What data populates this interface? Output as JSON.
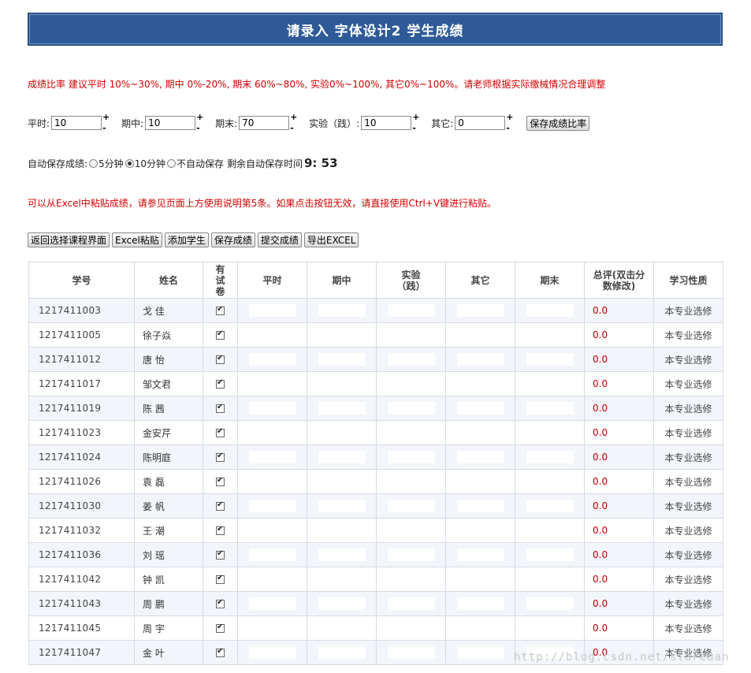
{
  "header": {
    "title": "请录入 字体设计2 学生成绩"
  },
  "notes": {
    "ratio_hint": "成绩比率 建议平时 10%~30%, 期中 0%-20%, 期末 60%~80%, 实验0%~100%, 其它0%~100%。请老师根据实际缴械情况合理调整",
    "excel_hint": "可以从Excel中粘贴成绩，请参见页面上方使用说明第5条。如果点击按钮无效，请直接使用Ctrl+V键进行粘贴。"
  },
  "ratios": [
    {
      "label": "平时:",
      "value": "10"
    },
    {
      "label": "期中:",
      "value": "10"
    },
    {
      "label": "期末:",
      "value": "70"
    },
    {
      "label": "实验（践）:",
      "value": "10"
    },
    {
      "label": "其它:",
      "value": "0"
    }
  ],
  "stepper": {
    "plus": "+",
    "minus": "-"
  },
  "save_ratio_label": "保存成绩比率",
  "autosave": {
    "label": "自动保存成绩:",
    "options": [
      "5分钟",
      "10分钟",
      "不自动保存"
    ],
    "selected_index": 1,
    "remaining_label": "剩余自动保存时间",
    "timer": "9: 53"
  },
  "toolbar": {
    "back": "返回选择课程界面",
    "paste": "Excel粘贴",
    "add": "添加学生",
    "save": "保存成绩",
    "submit": "提交成绩",
    "export": "导出EXCEL"
  },
  "table": {
    "headers": [
      "学号",
      "姓名",
      "有试卷",
      "平时",
      "期中",
      "实验（践）",
      "其它",
      "期末",
      "总评(双击分数修改)",
      "学习性质"
    ],
    "rows": [
      {
        "id": "1217411003",
        "name": "戈 佳",
        "total": "0.0",
        "nature": "本专业选修"
      },
      {
        "id": "1217411005",
        "name": "徐子焱",
        "total": "0.0",
        "nature": "本专业选修"
      },
      {
        "id": "1217411012",
        "name": "唐 怡",
        "total": "0.0",
        "nature": "本专业选修"
      },
      {
        "id": "1217411017",
        "name": "邹文君",
        "total": "0.0",
        "nature": "本专业选修"
      },
      {
        "id": "1217411019",
        "name": "陈 茜",
        "total": "0.0",
        "nature": "本专业选修"
      },
      {
        "id": "1217411023",
        "name": "金安芹",
        "total": "0.0",
        "nature": "本专业选修"
      },
      {
        "id": "1217411024",
        "name": "陈明庭",
        "total": "0.0",
        "nature": "本专业选修"
      },
      {
        "id": "1217411026",
        "name": "袁 磊",
        "total": "0.0",
        "nature": "本专业选修"
      },
      {
        "id": "1217411030",
        "name": "姜 帆",
        "total": "0.0",
        "nature": "本专业选修"
      },
      {
        "id": "1217411032",
        "name": "王 潮",
        "total": "0.0",
        "nature": "本专业选修"
      },
      {
        "id": "1217411036",
        "name": "刘 瑶",
        "total": "0.0",
        "nature": "本专业选修"
      },
      {
        "id": "1217411042",
        "name": "钟 凯",
        "total": "0.0",
        "nature": "本专业选修"
      },
      {
        "id": "1217411043",
        "name": "周 鹏",
        "total": "0.0",
        "nature": "本专业选修"
      },
      {
        "id": "1217411045",
        "name": "周 宇",
        "total": "0.0",
        "nature": "本专业选修"
      },
      {
        "id": "1217411047",
        "name": "金 叶",
        "total": "0.0",
        "nature": "本专业选修"
      }
    ]
  },
  "watermark": "http://blog.csdn.net/starcuan"
}
